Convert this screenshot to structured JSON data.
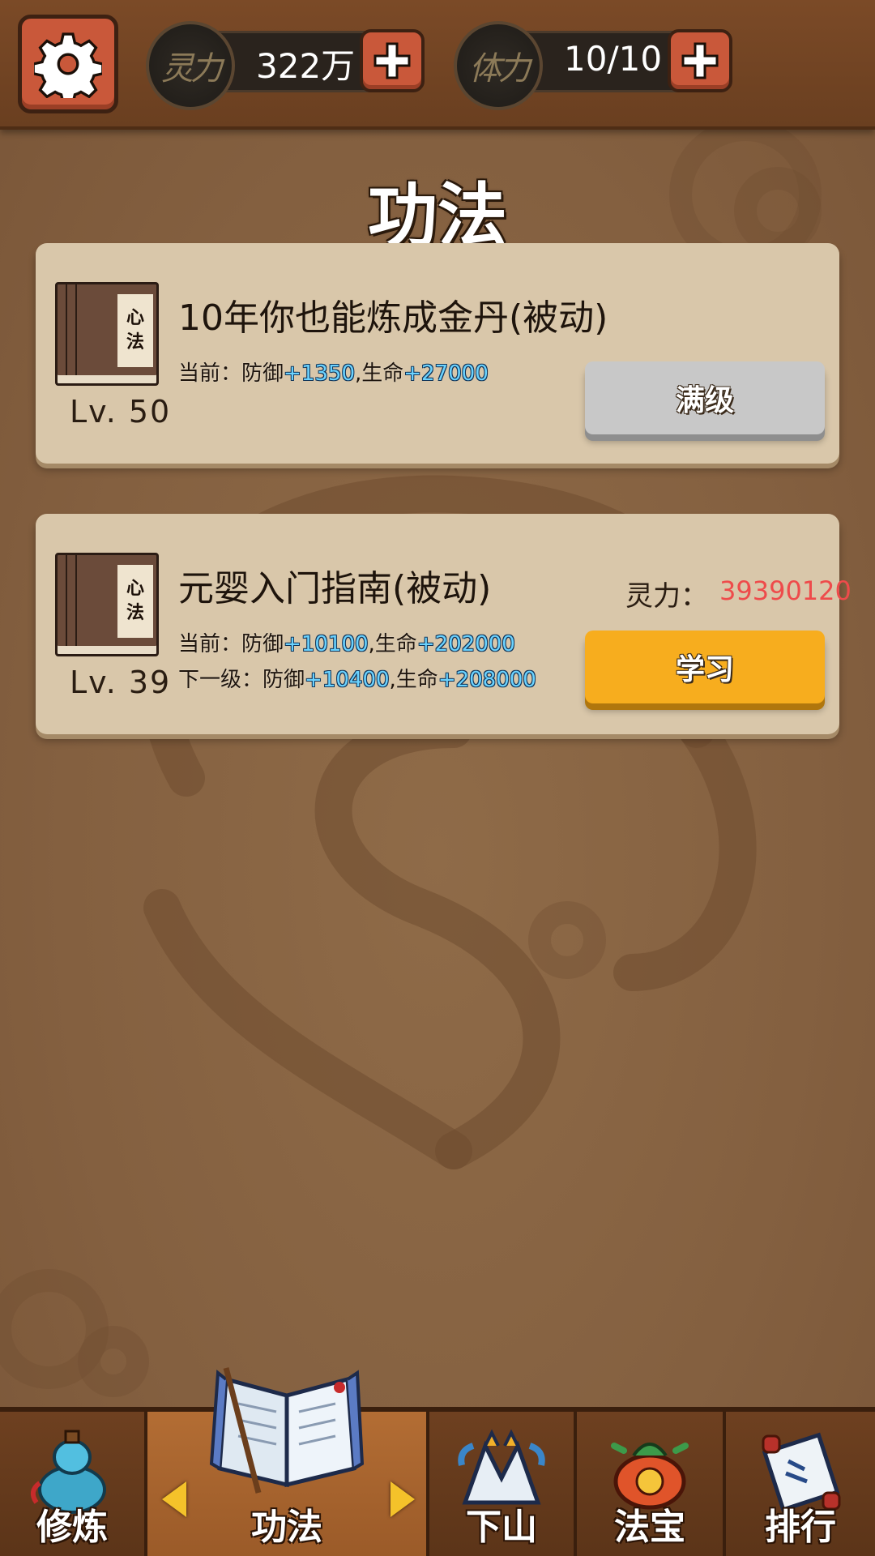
{
  "resources": {
    "spirit": {
      "emblem": "灵力",
      "value": "322万"
    },
    "stamina": {
      "emblem": "体力",
      "value": "10/10"
    }
  },
  "page": {
    "title": "功法"
  },
  "skills": [
    {
      "book_label": [
        "心",
        "法"
      ],
      "level": "Lv. 50",
      "name": "10年你也能炼成金丹(被动)",
      "current": {
        "label": "当前：",
        "def_label": "防御",
        "def": "+1350",
        "sep": ",",
        "hp_label": "生命",
        "hp": "+27000"
      },
      "button": "满级"
    },
    {
      "book_label": [
        "心",
        "法"
      ],
      "level": "Lv. 39",
      "name": "元婴入门指南(被动)",
      "current": {
        "label": "当前：",
        "def_label": "防御",
        "def": "+10100",
        "sep": ",",
        "hp_label": "生命",
        "hp": "+202000"
      },
      "next": {
        "label": "下一级：",
        "def_label": "防御",
        "def": "+10400",
        "sep": ",",
        "hp_label": "生命",
        "hp": "+208000"
      },
      "cost_label": "灵力：",
      "cost_value": "39390120",
      "button": "学习"
    }
  ],
  "nav": {
    "tabs": [
      {
        "label": "修炼",
        "icon": "gourd-icon"
      },
      {
        "label": "功法",
        "icon": "open-book-icon",
        "active": true
      },
      {
        "label": "下山",
        "icon": "mountain-icon"
      },
      {
        "label": "法宝",
        "icon": "treasure-bag-icon"
      },
      {
        "label": "排行",
        "icon": "scroll-icon"
      }
    ]
  },
  "colors": {
    "accent_button": "#f7ad1e",
    "stat_value": "#6bd3ff",
    "cost_value": "#ee4b4b",
    "top_button": "#c9583a"
  }
}
